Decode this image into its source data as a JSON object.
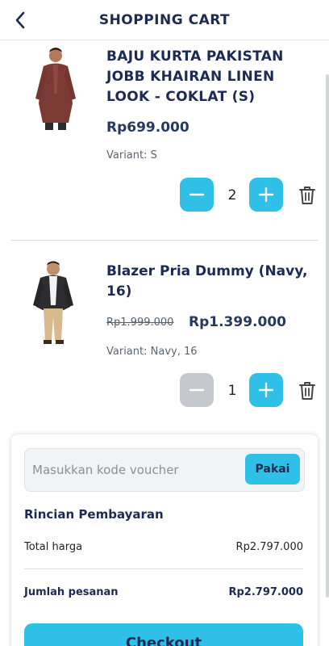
{
  "header": {
    "title": "SHOPPING CART"
  },
  "items": [
    {
      "name": "BAJU KURTA PAKISTAN JOBB KHAIRAN LINEN LOOK - COKLAT (S)",
      "price": "Rp699.000",
      "variant": "Variant: S",
      "quantity": "2"
    },
    {
      "name": "Blazer Pria Dummy (Navy, 16)",
      "old_price": "Rp1.999.000",
      "price": "Rp1.399.000",
      "variant": "Variant: Navy, 16",
      "quantity": "1"
    }
  ],
  "voucher": {
    "placeholder": "Masukkan kode voucher",
    "value": "",
    "apply_label": "Pakai"
  },
  "payment": {
    "title": "Rincian Pembayaran",
    "total_label": "Total harga",
    "total_value": "Rp2.797.000",
    "order_label": "Jumlah pesanan",
    "order_value": "Rp2.797.000"
  },
  "checkout_label": "Checkout",
  "colors": {
    "accent": "#2ec0e6",
    "navy": "#1d2a52",
    "disabled": "#c5c8cd"
  }
}
